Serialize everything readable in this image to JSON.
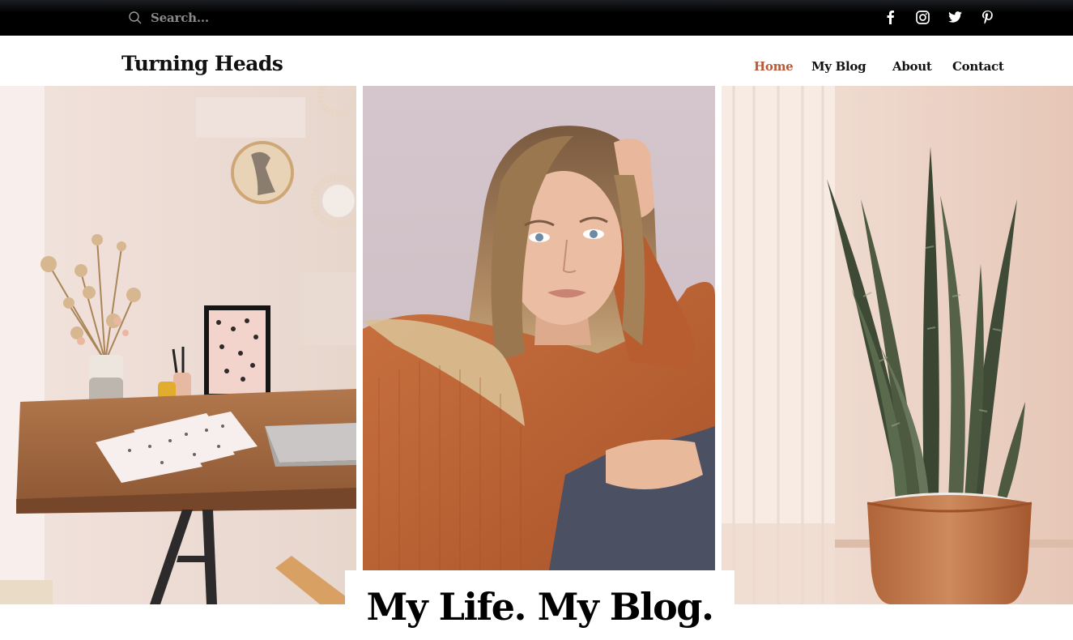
{
  "topbar": {
    "search_placeholder": "Search...",
    "search_icon": "search-icon",
    "socials": [
      "facebook-icon",
      "instagram-icon",
      "twitter-icon",
      "pinterest-icon"
    ]
  },
  "header": {
    "logo": "Turning Heads",
    "nav": [
      {
        "label": "Home",
        "active": true
      },
      {
        "label": "My Blog",
        "active": false
      },
      {
        "label": "About",
        "active": false
      },
      {
        "label": "Contact",
        "active": false
      }
    ]
  },
  "hero": {
    "title": "My Life. My Blog.",
    "images": [
      "desk-workspace-image",
      "woman-portrait-image",
      "snake-plant-image"
    ]
  },
  "colors": {
    "topbar_bg": "#000000",
    "nav_active": "#b8593a",
    "text": "#111111",
    "search_text": "#8a8a8a"
  }
}
